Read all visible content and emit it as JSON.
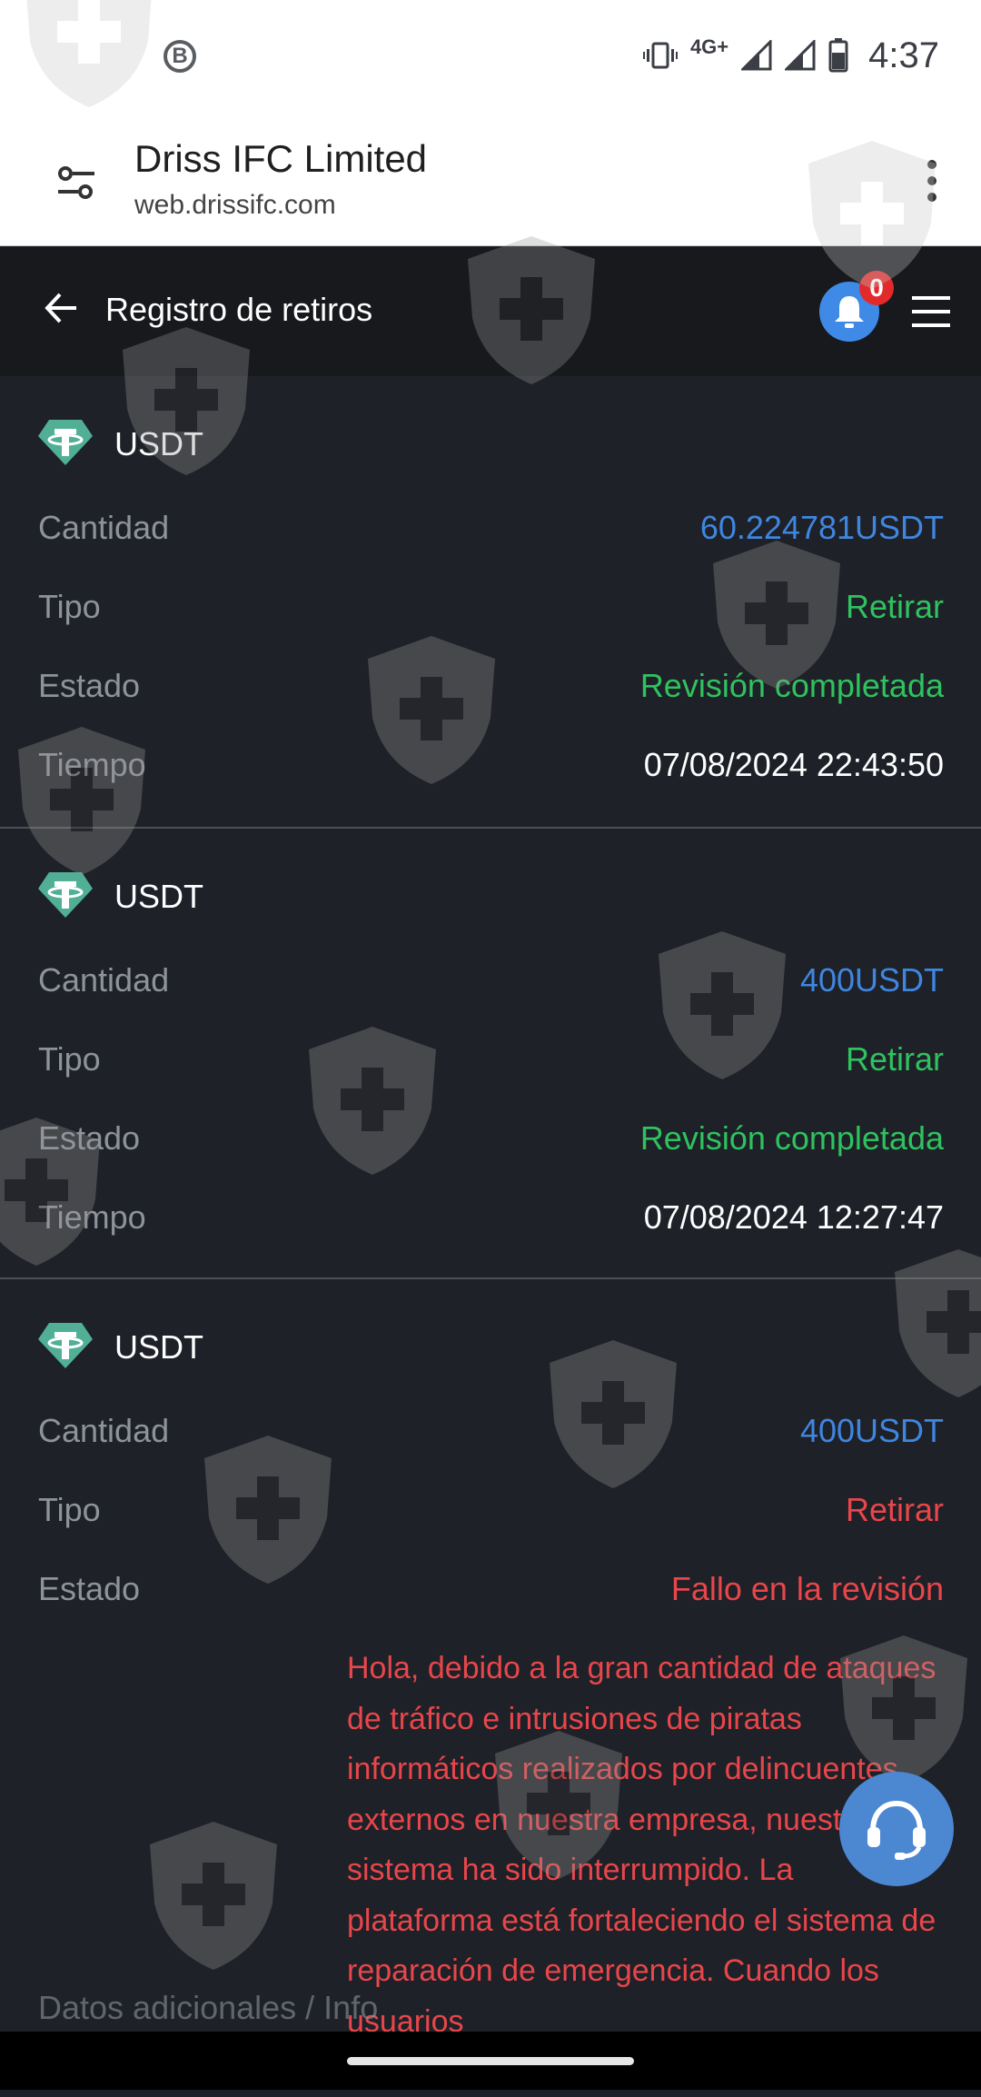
{
  "status_bar": {
    "notification_icon": "b-circle-icon",
    "network": "4G+",
    "time": "4:37"
  },
  "browser": {
    "site_title": "Driss IFC Limited",
    "site_url": "web.drissifc.com"
  },
  "app_header": {
    "title": "Registro de retiros",
    "notification_count": "0"
  },
  "labels": {
    "amount": "Cantidad",
    "type": "Tipo",
    "status": "Estado",
    "time": "Tiempo",
    "partial": "Datos adicionales / Info"
  },
  "records": [
    {
      "coin": "USDT",
      "amount": "60.224781USDT",
      "type": "Retirar",
      "status": "Revisión completada",
      "time": "07/08/2024 22:43:50"
    },
    {
      "coin": "USDT",
      "amount": "400USDT",
      "type": "Retirar",
      "status": "Revisión completada",
      "time": "07/08/2024 12:27:47"
    },
    {
      "coin": "USDT",
      "amount": "400USDT",
      "type": "Retirar",
      "status": "Fallo en la revisión",
      "message": "Hola, debido a la gran cantidad de ataques de tráfico e intrusiones de piratas informáticos realizados por delincuentes externos en nuestra empresa, nuestro sistema ha sido interrumpido. La plataforma está fortaleciendo el sistema de reparación de emergencia. Cuando los usuarios"
    }
  ],
  "colors": {
    "amount": "#3f86df",
    "success": "#2fc25f",
    "failure": "#e8464a",
    "background": "#1e2128"
  }
}
